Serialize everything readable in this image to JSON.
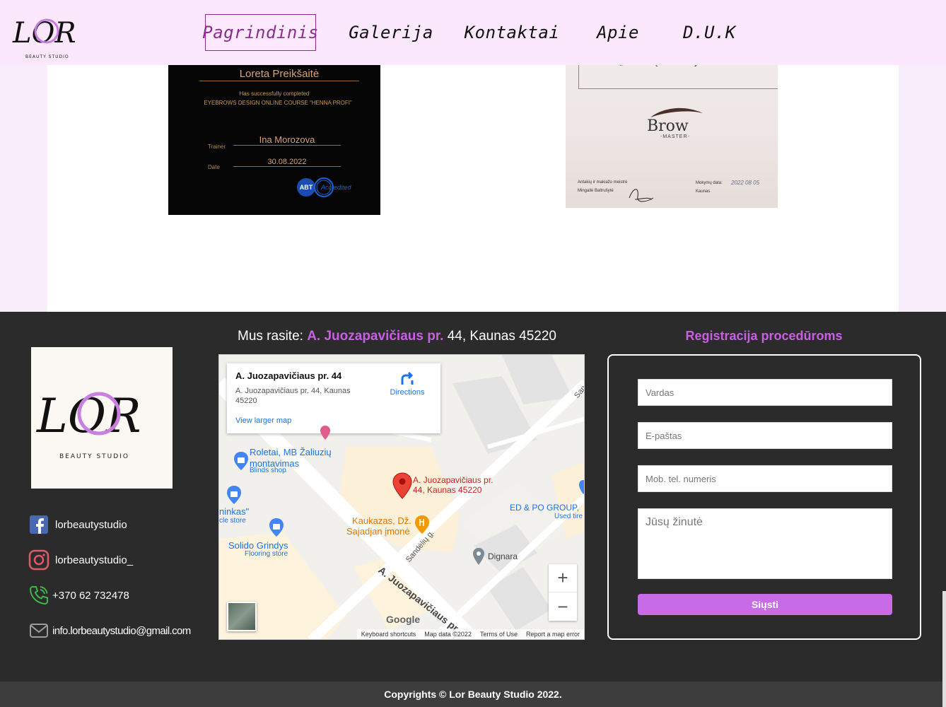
{
  "header": {
    "logo_text": "LOR",
    "logo_sub": "BEAUTY   STUDIO",
    "nav": [
      {
        "label": "Pagrindinis",
        "active": true
      },
      {
        "label": "Galerija"
      },
      {
        "label": "Kontaktai"
      },
      {
        "label": "Apie"
      },
      {
        "label": "D.U.K"
      }
    ]
  },
  "certificates": {
    "left": {
      "name": "Loreta Preikšaitė",
      "line1": "Has successfully completed",
      "line2": "EYEBROWS DESIGN ONLINE COURSE  “HENNA PROFI”",
      "trainer_label": "Trainer",
      "trainer_value": "Ina Morozova",
      "date_label": "Date",
      "date_value": "30.08.2022",
      "badge_left": "ABT",
      "badge_right": "Accredited"
    },
    "right": {
      "title": "„Antakių korekcija\"",
      "brand": "Brow",
      "brand_sub": "-MASTER-",
      "teacher_role": "Antakių ir makiažo meistrė",
      "teacher_name": "Mingailė Baltrušytė",
      "date_label": "Mokymų data:",
      "date_value": "2022 08 05",
      "city": "Kaunas"
    }
  },
  "footer": {
    "logo_text": "LOR",
    "logo_sub": "BEAUTY    STUDIO",
    "social": [
      {
        "icon": "facebook-icon",
        "label": "lorbeautystudio"
      },
      {
        "icon": "instagram-icon",
        "label": "lorbeautystudio_"
      },
      {
        "icon": "phone-icon",
        "label": "+370 62 732478"
      },
      {
        "icon": "mail-icon",
        "label": "info.lorbeautystudio@gmail.com"
      }
    ],
    "address": {
      "prefix": "Mus rasite: ",
      "street": "A. Juozapavičiaus pr.",
      "rest": " 44, Kaunas 45220"
    },
    "map": {
      "card_title": "A. Juozapavičiaus pr. 44",
      "card_address": "A. Juozapavičiaus pr. 44, Kaunas 45220",
      "directions": "Directions",
      "larger_map": "View larger map",
      "marker_label_1": "A. Juozapavičiaus pr.",
      "marker_label_2": "44, Kaunas 45220",
      "poi_1": "Roletai, MB Žaliuzių",
      "poi_1b": "montavimas",
      "poi_1c": "Blinds shop",
      "poi_2": "ninkas\"",
      "poi_2b": "cle store",
      "poi_3": "Solido Grindys",
      "poi_3b": "Flooring store",
      "poi_4": "Kaukazas, Dž.",
      "poi_4b": "Sajadjan įmonė",
      "poi_5": "ED & PO GROUP,",
      "poi_5b": "Used tire",
      "poi_6": "Dignara",
      "street_1": "Sandėlių g.",
      "street_2": "A. Juozapavičiaus pr.",
      "street_3": "San",
      "google": "Google",
      "shortcuts": "Keyboard shortcuts",
      "map_data": "Map data ©2022",
      "terms": "Terms of Use",
      "report": "Report a map error",
      "zoom_in": "+",
      "zoom_out": "−"
    },
    "registration": {
      "title": "Registracija procedūroms",
      "name_placeholder": "Vardas",
      "email_placeholder": "E-paštas",
      "phone_placeholder": "Mob. tel. numeris",
      "message_placeholder": "Jūsų žinutė",
      "submit_label": "Siųsti"
    },
    "copyright": "Copyrights © Lor Beauty Studio 2022."
  },
  "colors": {
    "accent": "#c95fe3",
    "header_bg": "#fbe8fc",
    "footer_bg": "#2b2b2b",
    "nav_active": "#8a2d8f"
  }
}
